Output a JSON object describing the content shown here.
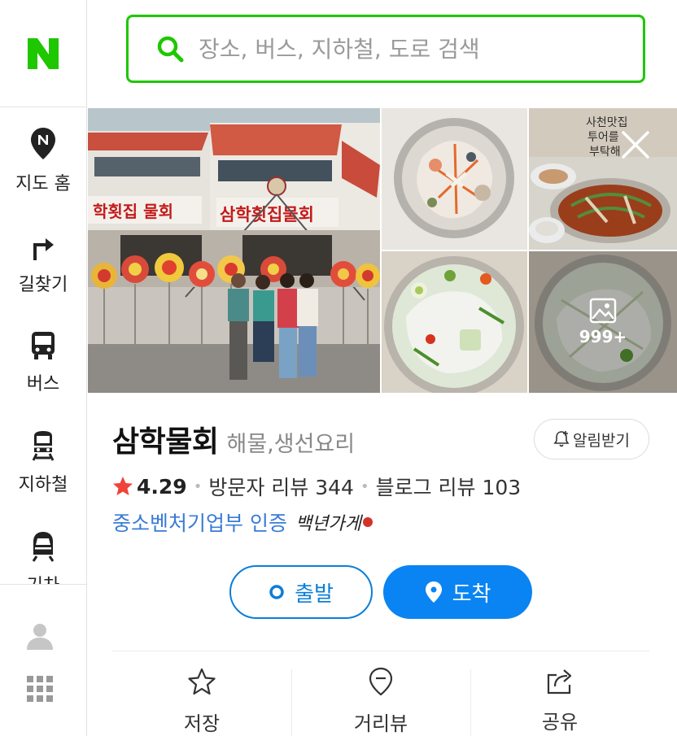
{
  "brand": {
    "logo": "N",
    "color": "#1ec700"
  },
  "sidebar": {
    "items": [
      {
        "label": "지도 홈",
        "icon": "map-pin-icon"
      },
      {
        "label": "길찾기",
        "icon": "turn-arrow-icon"
      },
      {
        "label": "버스",
        "icon": "bus-icon"
      },
      {
        "label": "지하철",
        "icon": "subway-icon"
      },
      {
        "label": "기차",
        "icon": "train-icon"
      }
    ],
    "bottom": {
      "profile_icon": "user-icon",
      "menu_icon": "apps-grid-icon"
    }
  },
  "search": {
    "placeholder": "장소, 버스, 지하철, 도로 검색",
    "value": "",
    "icon": "search-icon"
  },
  "photos": {
    "more_count": "999+",
    "close_icon": "close-icon",
    "gallery_icon": "image-icon"
  },
  "place": {
    "name": "삼학물회",
    "category": "해물,생선요리",
    "alarm_label": "알림받기",
    "rating": "4.29",
    "visitor_reviews": "방문자 리뷰 344",
    "blog_reviews": "블로그 리뷰 103",
    "certification": "중소벤처기업부 인증",
    "badge": "백년가게"
  },
  "route": {
    "depart_label": "출발",
    "arrive_label": "도착"
  },
  "actions": [
    {
      "label": "저장",
      "icon": "star-icon"
    },
    {
      "label": "거리뷰",
      "icon": "street-view-icon"
    },
    {
      "label": "공유",
      "icon": "share-icon"
    }
  ],
  "colors": {
    "brand_green": "#1ec700",
    "primary_blue": "#0a84f2",
    "link_blue": "#3a7bd5",
    "star_red": "#f0423b"
  }
}
